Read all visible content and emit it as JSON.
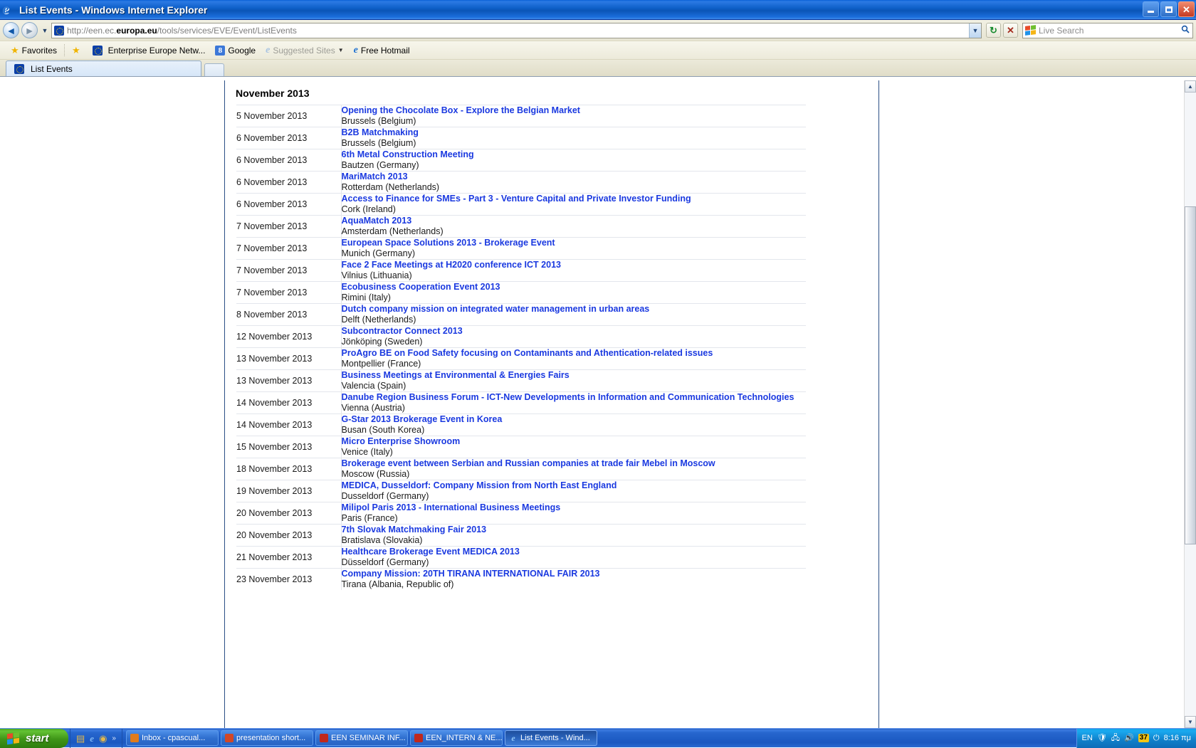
{
  "window": {
    "title": "List Events - Windows Internet Explorer",
    "app_icon": "ie-logo-icon",
    "minimize_label": "",
    "maximize_label": "",
    "close_label": "✕"
  },
  "navbar": {
    "back_glyph": "◄",
    "forward_glyph": "►",
    "history_glyph": "▼",
    "url_prefix": "http://een.ec.",
    "url_bold": "europa.eu",
    "url_suffix": "/tools/services/EVE/Event/ListEvents",
    "url_full": "http://een.ec.europa.eu/tools/services/EVE/Event/ListEvents",
    "address_dropdown_glyph": "▼",
    "refresh_glyph": "↻",
    "stop_glyph": "✕",
    "search_placeholder": "Live Search",
    "search_value": "",
    "search_go_glyph": "🔍"
  },
  "favorites_bar": {
    "favorites_label": "Favorites",
    "items": [
      {
        "label": "Enterprise Europe Netw...",
        "icon": "eu-flag-icon"
      },
      {
        "label": "Google",
        "icon": "google-icon"
      },
      {
        "label": "Suggested Sites",
        "icon": "ie-icon",
        "dim": true,
        "caret": "▼"
      },
      {
        "label": "Free Hotmail",
        "icon": "ie-doc-icon"
      }
    ]
  },
  "tabs": [
    {
      "label": "List Events",
      "icon": "eu-flag-icon",
      "active": true
    }
  ],
  "page": {
    "month_heading": "November 2013",
    "events": [
      {
        "date": "5 November 2013",
        "title": "Opening the Chocolate Box - Explore the Belgian Market",
        "location": "Brussels (Belgium)"
      },
      {
        "date": "6 November 2013",
        "title": "B2B Matchmaking",
        "location": "Brussels (Belgium)"
      },
      {
        "date": "6 November 2013",
        "title": "6th Metal Construction Meeting",
        "location": "Bautzen (Germany)"
      },
      {
        "date": "6 November 2013",
        "title": "MariMatch 2013",
        "location": "Rotterdam (Netherlands)"
      },
      {
        "date": "6 November 2013",
        "title": "Access to Finance for SMEs - Part 3 - Venture Capital and Private Investor Funding",
        "location": "Cork (Ireland)"
      },
      {
        "date": "7 November 2013",
        "title": "AquaMatch 2013",
        "location": "Amsterdam (Netherlands)"
      },
      {
        "date": "7 November 2013",
        "title": "European Space Solutions 2013 - Brokerage Event",
        "location": "Munich (Germany)"
      },
      {
        "date": "7 November 2013",
        "title": "Face 2 Face Meetings at H2020 conference ICT 2013",
        "location": "Vilnius (Lithuania)"
      },
      {
        "date": "7 November 2013",
        "title": "Ecobusiness Cooperation Event 2013",
        "location": "Rimini (Italy)"
      },
      {
        "date": "8 November 2013",
        "title": "Dutch company mission on integrated water management in urban areas",
        "location": "Delft (Netherlands)"
      },
      {
        "date": "12 November 2013",
        "title": "Subcontractor Connect 2013",
        "location": "Jönköping (Sweden)"
      },
      {
        "date": "13 November 2013",
        "title": "ProAgro BE on Food Safety focusing on Contaminants and Athentication-related issues",
        "location": "Montpellier (France)"
      },
      {
        "date": "13 November 2013",
        "title": "Business Meetings at Environmental & Energies Fairs",
        "location": "Valencia (Spain)"
      },
      {
        "date": "14 November 2013",
        "title": "Danube Region Business Forum - ICT-New Developments in Information and Communication Technologies",
        "location": "Vienna (Austria)"
      },
      {
        "date": "14 November 2013",
        "title": "G-Star 2013 Brokerage Event in Korea",
        "location": "Busan (South Korea)"
      },
      {
        "date": "15 November 2013",
        "title": "Micro Enterprise Showroom",
        "location": "Venice (Italy)"
      },
      {
        "date": "18 November 2013",
        "title": "Brokerage event between Serbian and Russian companies at trade fair Mebel in Moscow",
        "location": "Moscow (Russia)"
      },
      {
        "date": "19 November 2013",
        "title": "MEDICA, Dusseldorf: Company Mission from North East England",
        "location": "Dusseldorf (Germany)"
      },
      {
        "date": "20 November 2013",
        "title": "Milipol Paris 2013 - International Business Meetings",
        "location": "Paris (France)"
      },
      {
        "date": "20 November 2013",
        "title": "7th Slovak Matchmaking Fair 2013",
        "location": "Bratislava (Slovakia)"
      },
      {
        "date": "21 November 2013",
        "title": "Healthcare Brokerage Event MEDICA 2013",
        "location": "Düsseldorf (Germany)"
      },
      {
        "date": "23 November 2013",
        "title": "Company Mission: 20TH TIRANA INTERNATIONAL FAIR 2013",
        "location": "Tirana (Albania, Republic of)"
      }
    ]
  },
  "scrollbar": {
    "up_glyph": "▲",
    "down_glyph": "▼"
  },
  "taskbar": {
    "start_label": "start",
    "quick_launch": [
      {
        "icon": "show-desktop-icon"
      },
      {
        "icon": "ie-icon"
      },
      {
        "icon": "media-icon"
      },
      {
        "icon": "quicklaunch-chevron-icon",
        "glyph": "»"
      }
    ],
    "tasks": [
      {
        "label": "Inbox - cpascual...",
        "icon": "outlook-icon",
        "active": false
      },
      {
        "label": "presentation short...",
        "icon": "powerpoint-icon",
        "active": false
      },
      {
        "label": "EEN SEMINAR INF...",
        "icon": "pdf-icon",
        "active": false
      },
      {
        "label": "EEN_INTERN & NE...",
        "icon": "pdf-icon",
        "active": false
      },
      {
        "label": "List Events - Wind...",
        "icon": "ie-icon",
        "active": true
      }
    ],
    "tray": {
      "language": "EN",
      "icons": [
        "shield-icon",
        "network-icon",
        "volume-icon",
        "power-icon"
      ],
      "badge": "37",
      "clock": "8:16 πμ"
    }
  },
  "colors": {
    "titlebar_blue": "#0b55b6",
    "link_blue": "#1a39e0",
    "taskbar_blue": "#1a57c0",
    "start_green": "#3e9417",
    "frame_border": "#2b4f86"
  }
}
